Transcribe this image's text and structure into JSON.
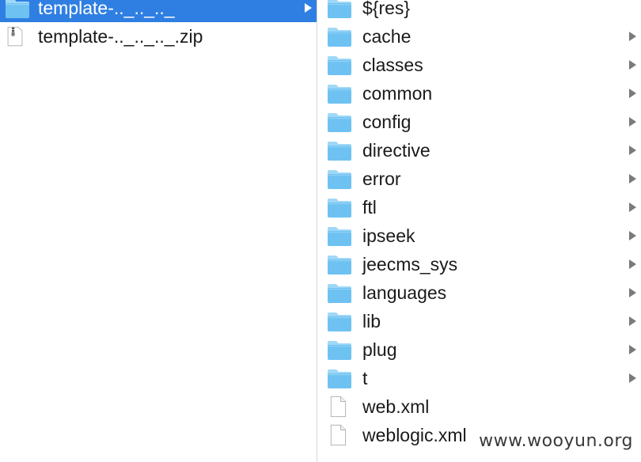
{
  "colors": {
    "selection": "#2f7fe3",
    "folder_body": "#6ec2f2",
    "folder_tab": "#9fd8f7",
    "text": "#1a1a1a",
    "chevron": "#7a7a7a"
  },
  "left_column": {
    "items": [
      {
        "name": "template-.._.._.._",
        "kind": "folder",
        "icon": "folder-icon",
        "selected": true,
        "has_children": true
      },
      {
        "name": "template-.._.._.._.zip",
        "kind": "zip",
        "icon": "zip-file-icon",
        "selected": false,
        "has_children": false
      }
    ]
  },
  "right_column": {
    "items": [
      {
        "name": "${res}",
        "kind": "folder",
        "icon": "folder-icon",
        "has_children": false
      },
      {
        "name": "cache",
        "kind": "folder",
        "icon": "folder-icon",
        "has_children": true
      },
      {
        "name": "classes",
        "kind": "folder",
        "icon": "folder-icon",
        "has_children": true
      },
      {
        "name": "common",
        "kind": "folder",
        "icon": "folder-icon",
        "has_children": true
      },
      {
        "name": "config",
        "kind": "folder",
        "icon": "folder-icon",
        "has_children": true
      },
      {
        "name": "directive",
        "kind": "folder",
        "icon": "folder-icon",
        "has_children": true
      },
      {
        "name": "error",
        "kind": "folder",
        "icon": "folder-icon",
        "has_children": true
      },
      {
        "name": "ftl",
        "kind": "folder",
        "icon": "folder-icon",
        "has_children": true
      },
      {
        "name": "ipseek",
        "kind": "folder",
        "icon": "folder-icon",
        "has_children": true
      },
      {
        "name": "jeecms_sys",
        "kind": "folder",
        "icon": "folder-icon",
        "has_children": true
      },
      {
        "name": "languages",
        "kind": "folder",
        "icon": "folder-icon",
        "has_children": true
      },
      {
        "name": "lib",
        "kind": "folder",
        "icon": "folder-icon",
        "has_children": true
      },
      {
        "name": "plug",
        "kind": "folder",
        "icon": "folder-icon",
        "has_children": true
      },
      {
        "name": "t",
        "kind": "folder",
        "icon": "folder-icon",
        "has_children": true
      },
      {
        "name": "web.xml",
        "kind": "file",
        "icon": "document-icon",
        "has_children": false
      },
      {
        "name": "weblogic.xml",
        "kind": "file",
        "icon": "document-icon",
        "has_children": false
      }
    ]
  },
  "watermark": {
    "text": "www.wooyun.org"
  }
}
